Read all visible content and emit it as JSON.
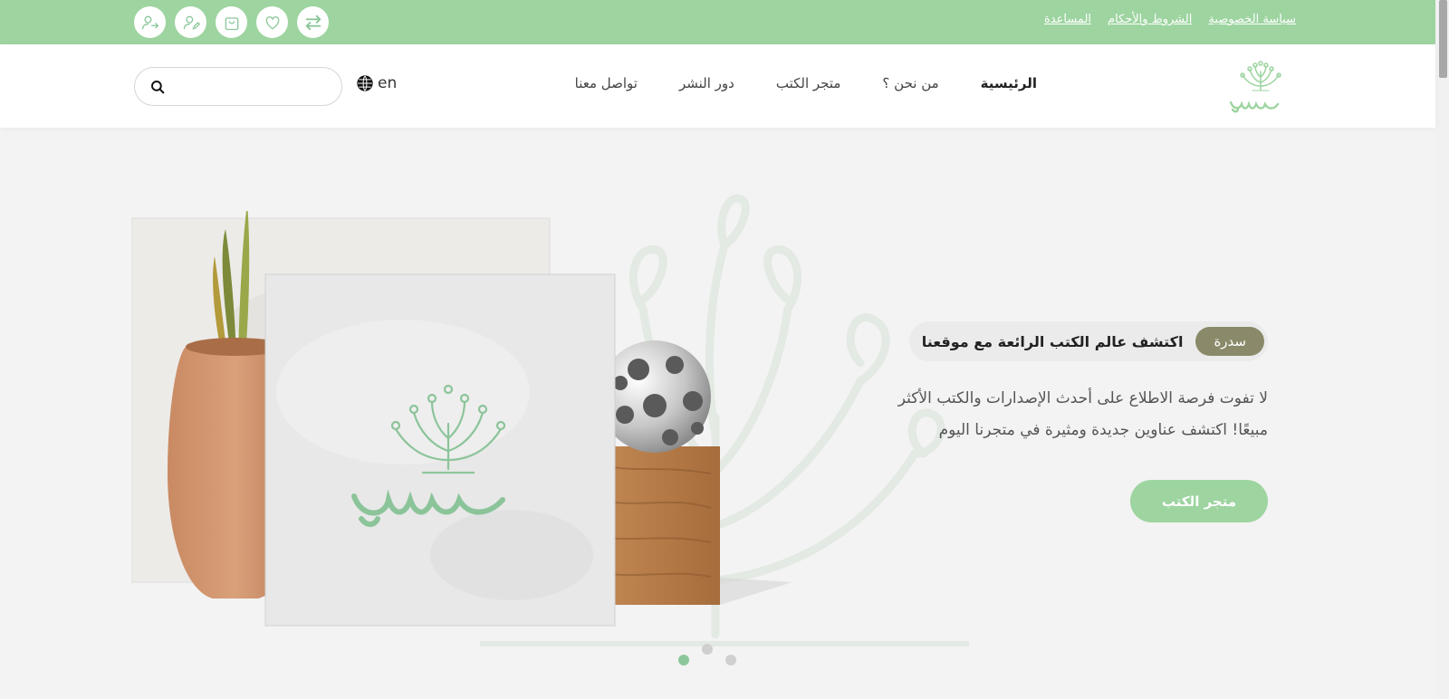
{
  "topbar": {
    "links": [
      {
        "label": "سياسة الخصوصية",
        "name": "privacy-policy-link"
      },
      {
        "label": "الشروط والأحكام",
        "name": "terms-link"
      },
      {
        "label": "المساعدة",
        "name": "help-link"
      }
    ],
    "icons": [
      "logout-icon",
      "user-edit-icon",
      "shopping-bag-icon",
      "heart-icon",
      "compare-arrows-icon"
    ]
  },
  "header": {
    "nav": [
      {
        "label": "الرئيسية",
        "name": "nav-home",
        "active": true
      },
      {
        "label": "من نحن ؟",
        "name": "nav-about"
      },
      {
        "label": "متجر الكتب",
        "name": "nav-bookstore"
      },
      {
        "label": "دور النشر",
        "name": "nav-publishers"
      },
      {
        "label": "تواصل معنا",
        "name": "nav-contact"
      }
    ],
    "lang": "en",
    "search_placeholder": ""
  },
  "hero": {
    "badge": "سدرة",
    "tagline": "اكتشف عالم الكتب الرائعة مع موقعنا",
    "description": "لا تفوت فرصة الاطلاع على أحدث الإصدارات والكتب الأكثر مبيعًا! اكتشف عناوين جديدة ومثيرة في متجرنا اليوم",
    "cta": "متجر الكتب"
  },
  "slider": {
    "count": 3,
    "active": 0
  },
  "colors": {
    "brand": "#9dd4a0",
    "badge": "#8a8a6a"
  }
}
